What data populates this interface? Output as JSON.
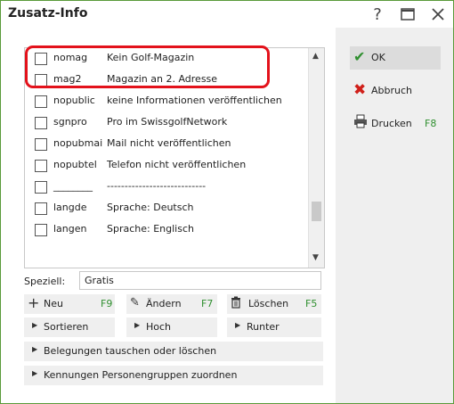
{
  "window": {
    "title": "Zusatz-Info"
  },
  "list": {
    "rows": [
      {
        "code": "nomag",
        "desc": "Kein Golf-Magazin"
      },
      {
        "code": "mag2",
        "desc": "Magazin an 2. Adresse"
      },
      {
        "code": "nopublic",
        "desc": "keine Informationen veröffentlichen"
      },
      {
        "code": "sgnpro",
        "desc": "Pro im SwissgolfNetwork"
      },
      {
        "code": "nopubmai",
        "desc": "Mail nicht veröffentlichen"
      },
      {
        "code": "nopubtel",
        "desc": "Telefon nicht veröffentlichen"
      },
      {
        "code": "________",
        "desc": "----------------------------"
      },
      {
        "code": "langde",
        "desc": "Sprache: Deutsch"
      },
      {
        "code": "langen",
        "desc": "Sprache: Englisch"
      }
    ]
  },
  "speziell": {
    "label": "Speziell:",
    "value": "Gratis"
  },
  "buttons": {
    "neu": {
      "label": "Neu",
      "key": "F9"
    },
    "aendern": {
      "label": "Ändern",
      "key": "F7"
    },
    "loeschen": {
      "label": "Löschen",
      "key": "F5"
    },
    "sortieren": {
      "label": "Sortieren"
    },
    "hoch": {
      "label": "Hoch"
    },
    "runter": {
      "label": "Runter"
    },
    "belegungen": {
      "label": "Belegungen tauschen oder löschen"
    },
    "kennungen": {
      "label": "Kennungen Personengruppen zuordnen"
    }
  },
  "side": {
    "ok": {
      "label": "OK"
    },
    "abbruch": {
      "label": "Abbruch"
    },
    "drucken": {
      "label": "Drucken",
      "key": "F8"
    }
  },
  "colors": {
    "accent_green": "#2f8f2f",
    "highlight_red": "#e3121b",
    "border_green": "#5a9a3a"
  }
}
